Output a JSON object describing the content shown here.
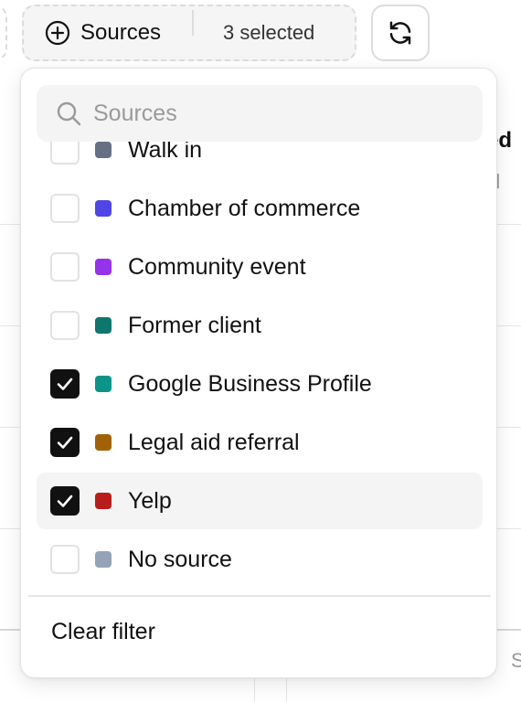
{
  "filter_chip": {
    "label": "Sources",
    "count_text": "3 selected",
    "add_icon": "plus-circle-icon"
  },
  "refresh_button": {
    "icon": "refresh-icon"
  },
  "background": {
    "column_title_fragment": "ed",
    "column_sub_fragment": "d",
    "bottom_fragment": "S"
  },
  "dropdown": {
    "search": {
      "placeholder": "Sources",
      "value": "",
      "icon": "search-icon"
    },
    "options": [
      {
        "label": "Walk in",
        "color": "#667085",
        "checked": false,
        "highlighted": false
      },
      {
        "label": "Chamber of commerce",
        "color": "#4F46E5",
        "checked": false,
        "highlighted": false
      },
      {
        "label": "Community event",
        "color": "#9333EA",
        "checked": false,
        "highlighted": false
      },
      {
        "label": "Former client",
        "color": "#0F766E",
        "checked": false,
        "highlighted": false
      },
      {
        "label": "Google Business Profile",
        "color": "#0D9488",
        "checked": true,
        "highlighted": false
      },
      {
        "label": "Legal aid referral",
        "color": "#A16207",
        "checked": true,
        "highlighted": false
      },
      {
        "label": "Yelp",
        "color": "#B91C1C",
        "checked": true,
        "highlighted": true
      },
      {
        "label": "No source",
        "color": "#94A3B8",
        "checked": false,
        "highlighted": false
      }
    ],
    "clear_label": "Clear filter"
  }
}
